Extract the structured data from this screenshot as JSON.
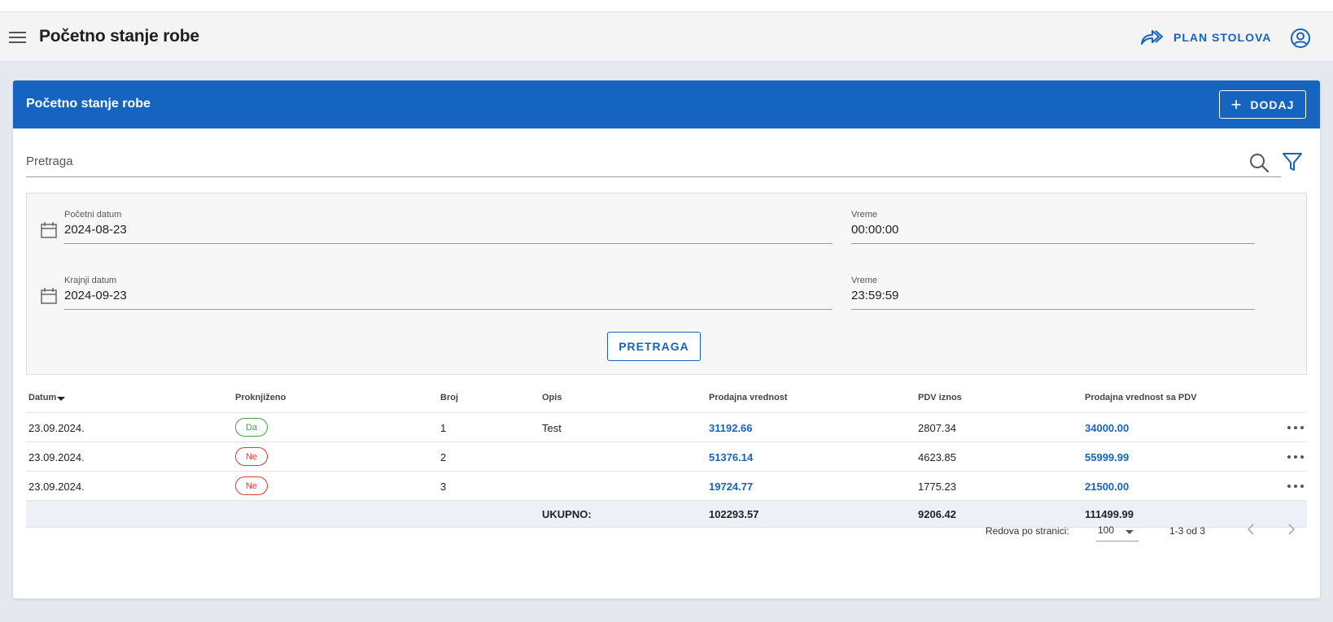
{
  "appbar": {
    "title": "Početno stanje robe",
    "plan_label": "PLAN STOLOVA"
  },
  "card": {
    "title": "Početno stanje robe",
    "add_label": "DODAJ"
  },
  "search": {
    "placeholder": "Pretraga"
  },
  "filters": {
    "start_date_label": "Početni datum",
    "start_date": "2024-08-23",
    "start_time_label": "Vreme",
    "start_time": "00:00:00",
    "end_date_label": "Krajnji datum",
    "end_date": "2024-09-23",
    "end_time_label": "Vreme",
    "end_time": "23:59:59",
    "search_button": "PRETRAGA"
  },
  "table": {
    "columns": [
      "Datum",
      "Proknjiženo",
      "Broj",
      "Opis",
      "Prodajna vrednost",
      "PDV iznos",
      "Prodajna vrednost sa PDV"
    ],
    "rows": [
      {
        "datum": "23.09.2024.",
        "proknjizeno": "Da",
        "broj": "1",
        "opis": "Test",
        "prodajna": "31192.66",
        "pdv": "2807.34",
        "sa_pdv": "34000.00"
      },
      {
        "datum": "23.09.2024.",
        "proknjizeno": "Ne",
        "broj": "2",
        "opis": "",
        "prodajna": "51376.14",
        "pdv": "4623.85",
        "sa_pdv": "55999.99"
      },
      {
        "datum": "23.09.2024.",
        "proknjizeno": "Ne",
        "broj": "3",
        "opis": "",
        "prodajna": "19724.77",
        "pdv": "1775.23",
        "sa_pdv": "21500.00"
      }
    ],
    "total_label": "UKUPNO:",
    "total_prodajna": "102293.57",
    "total_pdv": "9206.42",
    "total_sa_pdv": "111499.99"
  },
  "pager": {
    "rows_per_page_label": "Redova po stranici:",
    "rows_per_page": "100",
    "range": "1-3 od 3"
  },
  "colors": {
    "primary": "#1565c0",
    "yes": "#43a047",
    "no": "#e53935"
  }
}
